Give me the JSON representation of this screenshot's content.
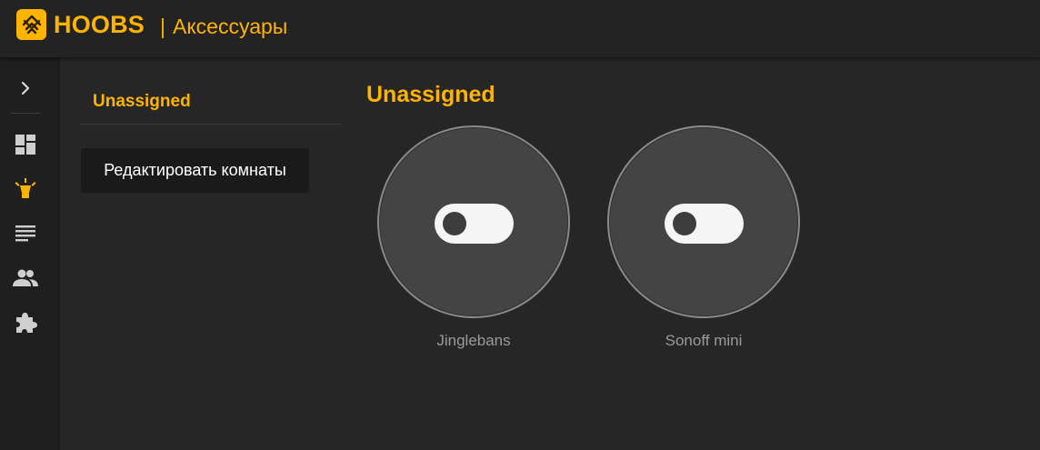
{
  "header": {
    "brand": "HOOBS",
    "separator": "|",
    "page_title": "Аксессуары"
  },
  "sidebar": {
    "items": [
      {
        "name": "expand",
        "icon": "chevron-right-icon",
        "active": false
      },
      {
        "name": "dashboard",
        "icon": "dashboard-icon",
        "active": false
      },
      {
        "name": "accessories",
        "icon": "lightbulb-icon",
        "active": true
      },
      {
        "name": "log",
        "icon": "log-lines-icon",
        "active": false
      },
      {
        "name": "users",
        "icon": "users-icon",
        "active": false
      },
      {
        "name": "plugins",
        "icon": "puzzle-icon",
        "active": false
      }
    ]
  },
  "rooms": {
    "items": [
      {
        "label": "Unassigned"
      }
    ],
    "edit_button": "Редактировать комнаты"
  },
  "main": {
    "section_title": "Unassigned",
    "accessories": [
      {
        "name": "Jinglebans",
        "state": "off"
      },
      {
        "name": "Sonoff mini",
        "state": "off"
      }
    ]
  },
  "colors": {
    "accent": "#feb400",
    "background": "#262626",
    "sidebar_icon": "#cfcfcf",
    "tile": "#444444",
    "toggle_track": "#f5f5f5"
  }
}
